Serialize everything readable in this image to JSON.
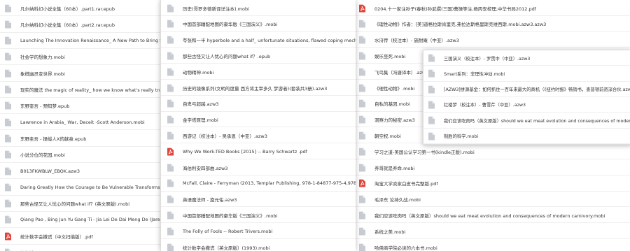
{
  "colors": {
    "file_icon": "#c8ccd2",
    "pdf_icon": "#e0453b",
    "text": "#333333"
  },
  "panels": [
    {
      "id": "left",
      "items": [
        {
          "name": "凡尔纳科幻小说全集（60本）.part1.rar.epub",
          "icon": "file-icon"
        },
        {
          "name": "凡尔纳科幻小说全集（60本）.part2.rar.epub",
          "icon": "file-icon"
        },
        {
          "name": "Launching The Innovation Renaissance_ A New Path to Bring Smart Ideas to",
          "icon": "file-icon"
        },
        {
          "name": "社会学的想象力.mobi",
          "icon": "file-icon"
        },
        {
          "name": "象棋幽灵变世界.mobi",
          "icon": "file-icon"
        },
        {
          "name": "现实的魔法 the magic of reality_ how we know what's really true(英文原版).mobi",
          "icon": "file-icon"
        },
        {
          "name": "东野奎吾 - 预知梦.epub",
          "icon": "file-icon"
        },
        {
          "name": "Lawrence in Arabia_ War, Deceit -Scott Anderson.mobi",
          "icon": "file-icon"
        },
        {
          "name": "东野圭吾 - 操縦人X的献身.epub",
          "icon": "file-icon"
        },
        {
          "name": "小说分位的花园.mobi",
          "icon": "file-icon"
        },
        {
          "name": "B013FKWBLW_EBOK.azw3",
          "icon": "file-icon"
        },
        {
          "name": "Daring Greatly How the Courage to Be Vulnerable Transforms the Way We L",
          "icon": "file-icon"
        },
        {
          "name": "那些古怪又让人忧心的问题what if？(英文原版).mobi",
          "icon": "file-icon"
        },
        {
          "name": "Qiang Pao , Bing Jun Yu Gang Ti - Jia Lei De Dai Meng De (Jared D.azw3",
          "icon": "file-icon"
        },
        {
          "name": "统计数字会撒谎（中文扫描版）.pdf",
          "icon": "pdf-icon"
        },
        {
          "name": "海权论.mobi",
          "icon": "file-icon"
        }
      ]
    },
    {
      "id": "middle",
      "items": [
        {
          "name": "历史(哥罗多德新译详注本).mobi",
          "icon": "file-icon"
        },
        {
          "name": "中国首部睡配地图的豪华版《三国演义》.mobi",
          "icon": "file-icon"
        },
        {
          "name": "夸张和一半 hyperbole and a half_ unfortunate situations, flawed coping mechanisms, mayhe",
          "icon": "file-icon"
        },
        {
          "name": "那些古怪又让人忧心的问题what if？.epub",
          "icon": "file-icon"
        },
        {
          "name": "动物精神.mobi",
          "icon": "file-icon"
        },
        {
          "name": "历史的镜像系列(文明的度量 西方将主宰多久 梦游者)(套装共3册).azw3",
          "icon": "file-icon"
        },
        {
          "name": "自卑与超越.azw3",
          "icon": "file-icon"
        },
        {
          "name": "金字塔原理.mobi",
          "icon": "file-icon"
        },
        {
          "name": "西游记（校注本）- 吴承恩（中亚）.azw3",
          "icon": "file-icon"
        },
        {
          "name": "Why We Work-TED Books [2015] -- Barry Schwartz .pdf",
          "icon": "pdf-icon"
        },
        {
          "name": "海伯利安四部曲.azw3",
          "icon": "file-icon"
        },
        {
          "name": "McFall, Claire - Ferryman (2013, Templar Publishing, 978-1-84877-975-4,978-1-848.mobi",
          "icon": "file-icon"
        },
        {
          "name": "英语魔法师 - 旋元佑.azw3",
          "icon": "file-icon"
        },
        {
          "name": "中国首部睡配地图的豪华版《三国演义》.mobi",
          "icon": "file-icon"
        },
        {
          "name": "The Folly of Fools -- Robert Trivers.mobi",
          "icon": "file-icon"
        },
        {
          "name": "统计数字会撒谎（英文原版）(1993).mobi",
          "icon": "file-icon"
        }
      ]
    },
    {
      "id": "right",
      "items": [
        {
          "name": "0204.十一家注孙子(春秋)孙武撰(三国)曹操等注,杨丙安校理,中华书局2012.pdf",
          "icon": "pdf-icon"
        },
        {
          "name": "《理性动物》作者：[美]道格拉斯肯里克,弗拉达斯格里斯克维西斯.mobi.azw3.azw3",
          "icon": "file-icon"
        },
        {
          "name": "水浒传（校注本）- 施耐庵（中亚）.azw3",
          "icon": "file-icon"
        },
        {
          "name": "娱乐至死.mobi",
          "icon": "file-icon"
        },
        {
          "name": "飞鸟集（冯唐译本）.azw3",
          "icon": "file-icon"
        },
        {
          "name": "《理性动物》.mobi",
          "icon": "file-icon"
        },
        {
          "name": "自私的基因.mobi",
          "icon": "file-icon"
        },
        {
          "name": "洞察力的秘密.azw3",
          "icon": "file-icon"
        },
        {
          "name": "朝空权.mobi",
          "icon": "file-icon"
        },
        {
          "name": "学习之道-美国公认学习第一书(kindle正版).mobi",
          "icon": "file-icon"
        },
        {
          "name": "养哥就是养命.mobi",
          "icon": "file-icon"
        },
        {
          "name": "淘宝大学卖家白皮书完整版.pdf",
          "icon": "pdf-icon"
        },
        {
          "name": "毛泽东 论持久战.mobi",
          "icon": "file-icon"
        },
        {
          "name": "我们应该吃肉吗（英文原版）should we eat meat evolution and consequences of modern carnivory.mobi",
          "icon": "file-icon"
        },
        {
          "name": "系统之美.mobi",
          "icon": "file-icon"
        },
        {
          "name": "哈佛商学院必读的六本书.mobi",
          "icon": "file-icon"
        }
      ]
    },
    {
      "id": "popup",
      "items": [
        {
          "name": "三国演义（校注本）- 罗贯中（中亚）.azw3",
          "icon": "file-icon"
        },
        {
          "name": "Smart系列：非理性冲动.mobi",
          "icon": "file-icon"
        },
        {
          "name": "[AZW3]拼源基金：如何抓住一百年来最大的商机（《纽约时报》畅销书，查普顿前资深合伙.azw3",
          "icon": "file-icon"
        },
        {
          "name": "红楼梦（校注本）- 曹雪芹（中亚）.azw3",
          "icon": "file-icon"
        },
        {
          "name": "我们应该吃肉吗（英文原版）should we eat meat evolution and consequences of modern carnivory.",
          "icon": "file-icon"
        },
        {
          "name": "制胜的科学.mobi",
          "icon": "file-icon"
        }
      ]
    }
  ]
}
